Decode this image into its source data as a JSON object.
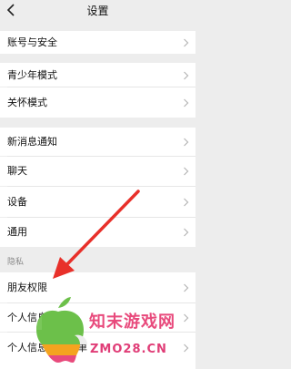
{
  "header": {
    "title": "设置",
    "back_icon": "chevron-left-icon"
  },
  "groups": [
    {
      "items": [
        {
          "label": "账号与安全"
        }
      ]
    },
    {
      "items": [
        {
          "label": "青少年模式"
        },
        {
          "label": "关怀模式"
        }
      ]
    },
    {
      "items": [
        {
          "label": "新消息通知"
        },
        {
          "label": "聊天"
        },
        {
          "label": "设备"
        },
        {
          "label": "通用"
        }
      ]
    }
  ],
  "privacy": {
    "caption": "隐私",
    "items": [
      {
        "label": "朋友权限"
      },
      {
        "label": "个人信息"
      },
      {
        "label": "个人信息收集清单"
      }
    ]
  },
  "watermark": {
    "name": "知末游戏网",
    "domain": "ZMO28.CN",
    "colors": {
      "brand": "#e84a7c"
    }
  },
  "annotation": {
    "type": "red-arrow",
    "color": "#e8302a"
  }
}
